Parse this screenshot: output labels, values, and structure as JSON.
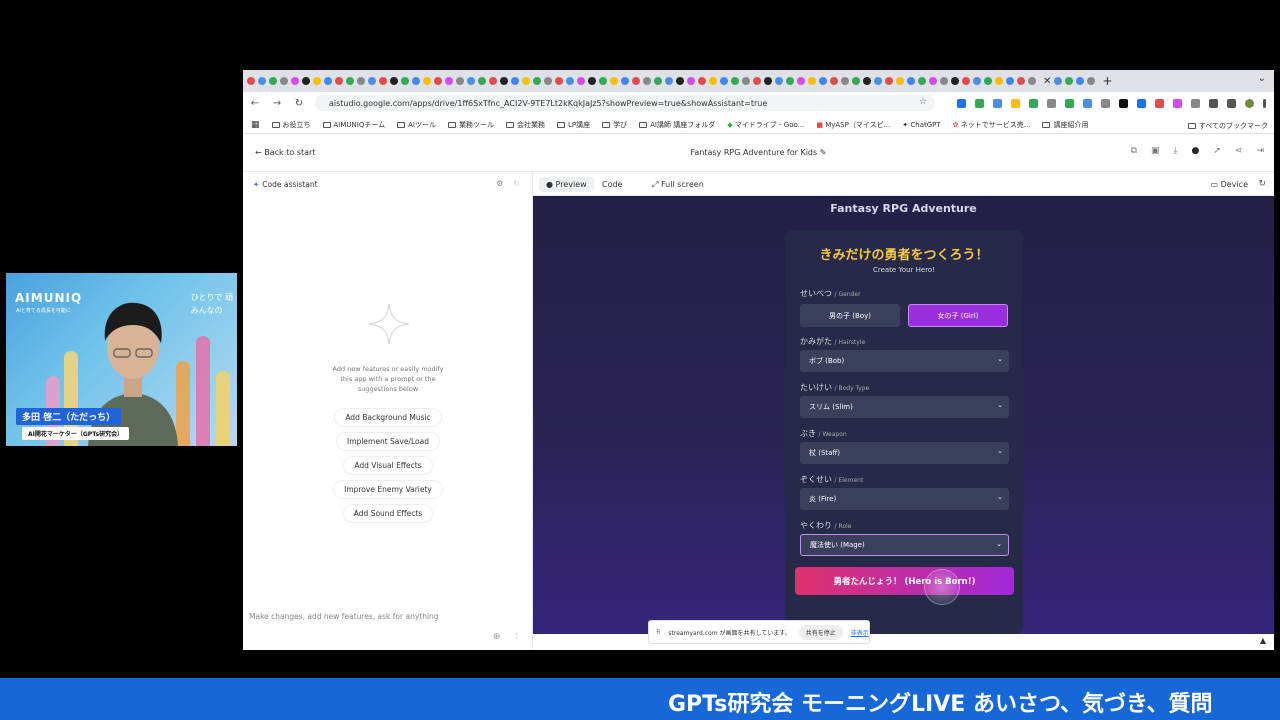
{
  "browser": {
    "url": "aistudio.google.com/apps/drive/1ff6SxTfnc_ACI2V-9TE7Lt2kKqkJaJz5?showPreview=true&showAssistant=true",
    "bookmarks": [
      "お役立ち",
      "AIMUNIQチーム",
      "AIツール",
      "業務ツール",
      "会社業務",
      "LP講座",
      "学び",
      "AI講師 講座フォルダ",
      "マイドライブ - Goo...",
      "MyASP（マイスピ...",
      "ChatGPT",
      "ネットでサービス売...",
      "講座紹介用"
    ],
    "all_bookmarks": "すべてのブックマーク"
  },
  "studio": {
    "back": "Back to start",
    "project_title": "Fantasy RPG Adventure for Kids"
  },
  "assistant": {
    "title": "Code assistant",
    "hint": "Add new features or easily modify this app with a prompt or the suggestions below",
    "suggestions": [
      "Add Background Music",
      "Implement Save/Load",
      "Add Visual Effects",
      "Improve Enemy Variety",
      "Add Sound Effects"
    ],
    "input_placeholder": "Make changes, add new features, ask for anything"
  },
  "preview_tabs": {
    "preview": "Preview",
    "code": "Code",
    "fullscreen": "Full screen",
    "device": "Device"
  },
  "app": {
    "heading": "Fantasy RPG Adventure",
    "title": "きみだけの勇者をつくろう！",
    "subtitle": "Create Your Hero!",
    "gender_label": "せいべつ",
    "gender_label_en": "/ Gender",
    "boy": "男の子 (Boy)",
    "girl": "女の子 (Girl)",
    "hair_label": "かみがた",
    "hair_label_en": "/ Hairstyle",
    "hair_value": "ボブ (Bob)",
    "body_label": "たいけい",
    "body_label_en": "/ Body Type",
    "body_value": "スリム (Slim)",
    "weapon_label": "ぶき",
    "weapon_label_en": "/ Weapon",
    "weapon_value": "杖 (Staff)",
    "element_label": "ぞくせい",
    "element_label_en": "/ Element",
    "element_value": "炎 (Fire)",
    "role_label": "やくわり",
    "role_label_en": "/ Role",
    "role_value": "魔法使い (Mage)",
    "born_button": "勇者たんじょう！ (Hero is Born!)"
  },
  "share": {
    "message": "streamyard.com が画面を共有しています。",
    "stop": "共有を停止",
    "hide": "非表示"
  },
  "webcam": {
    "logo": "AIMUNIQ",
    "tagline": "AIと育てる成長を可能に",
    "slogan_line1": "ひとりで 頑",
    "slogan_line2": "みんなの",
    "name": "多田 啓二（ただっち）",
    "role": "AI開花マーケター（GPTs研究会）"
  },
  "ticker": {
    "text": "GPTs研究会 モーニングLIVE あいさつ、気づき、質問"
  },
  "colors": {
    "accent_purple": "#9b2fe0",
    "title_yellow": "#f6c744",
    "ticker_blue": "#1668d8"
  }
}
